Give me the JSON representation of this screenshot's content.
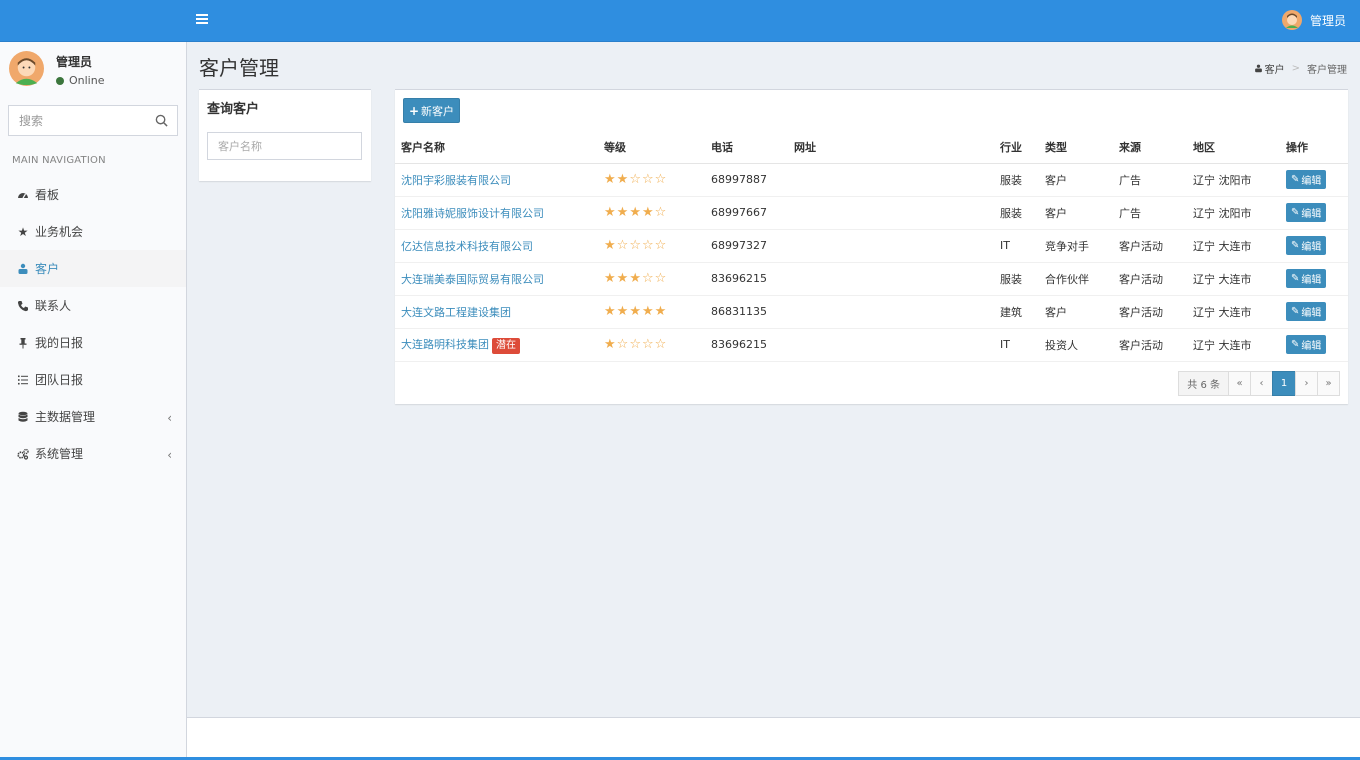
{
  "topbar": {
    "user_name": "管理员"
  },
  "sidebar": {
    "user_name": "管理员",
    "status": "Online",
    "search_placeholder": "搜索",
    "nav_header": "MAIN NAVIGATION",
    "items": [
      {
        "label": "看板",
        "icon": "dashboard-icon"
      },
      {
        "label": "业务机会",
        "icon": "star-icon"
      },
      {
        "label": "客户",
        "icon": "sitemap-icon",
        "active": true
      },
      {
        "label": "联系人",
        "icon": "phone-icon"
      },
      {
        "label": "我的日报",
        "icon": "pin-icon"
      },
      {
        "label": "团队日报",
        "icon": "list-icon"
      },
      {
        "label": "主数据管理",
        "icon": "database-icon",
        "has_children": true
      },
      {
        "label": "系统管理",
        "icon": "cogs-icon",
        "has_children": true
      }
    ],
    "chevron": "‹"
  },
  "page": {
    "title": "客户管理",
    "breadcrumb": {
      "link": "客户",
      "current": "客户管理",
      "separator": ">"
    }
  },
  "query": {
    "title": "查询客户",
    "name_placeholder": "客户名称"
  },
  "table": {
    "new_button": "新客户",
    "columns": [
      "客户名称",
      "等级",
      "电话",
      "网址",
      "行业",
      "类型",
      "来源",
      "地区",
      "操作"
    ],
    "edit_label": "编辑",
    "rows": [
      {
        "name": "沈阳宇彩服装有限公司",
        "badge": "",
        "rating": 2,
        "phone": "68997887",
        "website": "",
        "industry": "服装",
        "type": "客户",
        "source": "广告",
        "region": "辽宁 沈阳市"
      },
      {
        "name": "沈阳雅诗妮服饰设计有限公司",
        "badge": "",
        "rating": 4,
        "phone": "68997667",
        "website": "",
        "industry": "服装",
        "type": "客户",
        "source": "广告",
        "region": "辽宁 沈阳市"
      },
      {
        "name": "亿达信息技术科技有限公司",
        "badge": "",
        "rating": 1,
        "phone": "68997327",
        "website": "",
        "industry": "IT",
        "type": "竞争对手",
        "source": "客户活动",
        "region": "辽宁 大连市"
      },
      {
        "name": "大连瑞美泰国际贸易有限公司",
        "badge": "",
        "rating": 3,
        "phone": "83696215",
        "website": "",
        "industry": "服装",
        "type": "合作伙伴",
        "source": "客户活动",
        "region": "辽宁 大连市"
      },
      {
        "name": "大连文路工程建设集团",
        "badge": "",
        "rating": 5,
        "phone": "86831135",
        "website": "",
        "industry": "建筑",
        "type": "客户",
        "source": "客户活动",
        "region": "辽宁 大连市"
      },
      {
        "name": "大连路明科技集团",
        "badge": "潜在",
        "rating": 1,
        "phone": "83696215",
        "website": "",
        "industry": "IT",
        "type": "投资人",
        "source": "客户活动",
        "region": "辽宁 大连市"
      }
    ]
  },
  "pagination": {
    "total": "共 6 条",
    "first": "«",
    "prev": "‹",
    "current": "1",
    "next": "›",
    "last": "»"
  },
  "colors": {
    "primary": "#2f8ee0",
    "button": "#3c8dbc",
    "badge": "#dd4b39",
    "star": "#f0ad4e"
  }
}
